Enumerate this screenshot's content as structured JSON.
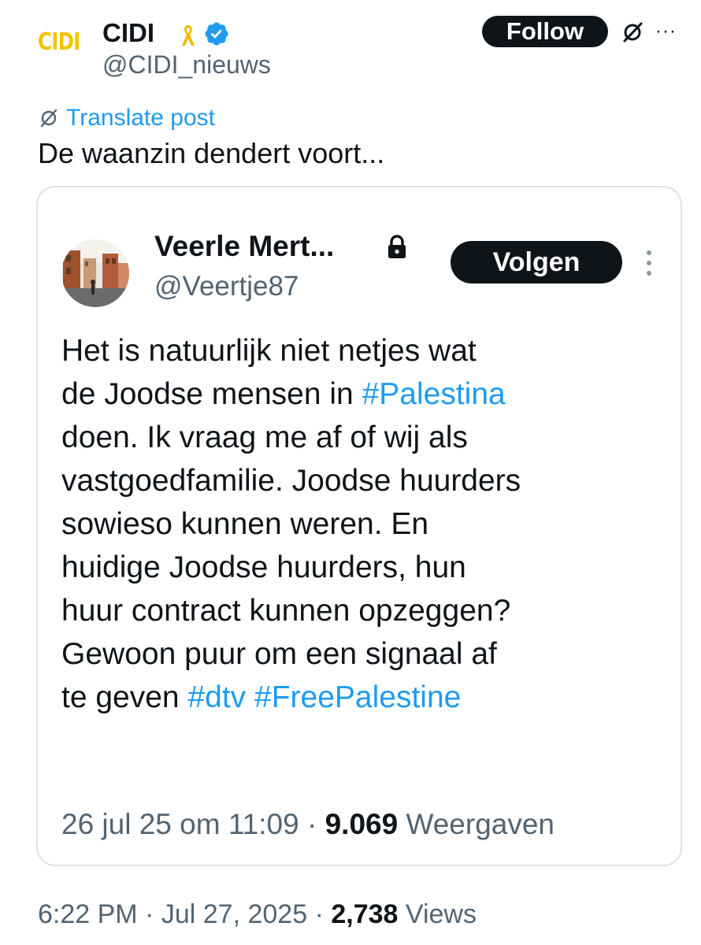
{
  "post": {
    "logo_text": "CIDI",
    "author_name": "CIDI",
    "author_handle": "@CIDI_nieuws",
    "follow_label": "Follow",
    "more_label": "···",
    "translate_label": "Translate post",
    "text": "De waanzin dendert voort...",
    "time": "6:22 PM",
    "date": "Jul 27, 2025",
    "views_count": "2,738",
    "views_label": "Views"
  },
  "quote": {
    "author_name": "Veerle Mert...",
    "author_handle": "@Veertje87",
    "follow_label": "Volgen",
    "lines": [
      [
        {
          "t": "Het is natuurlijk niet netjes wat"
        }
      ],
      [
        {
          "t": "de Joodse mensen in "
        },
        {
          "t": "#Palestina",
          "tag": true
        }
      ],
      [
        {
          "t": "doen. Ik vraag me af of wij als"
        }
      ],
      [
        {
          "t": "vastgoedfamilie. Joodse huurders"
        }
      ],
      [
        {
          "t": "sowieso kunnen weren. En"
        }
      ],
      [
        {
          "t": "huidige Joodse huurders, hun"
        }
      ],
      [
        {
          "t": "huur contract kunnen opzeggen?"
        }
      ],
      [
        {
          "t": "Gewoon puur om een signaal af"
        }
      ],
      [
        {
          "t": "te geven "
        },
        {
          "t": "#dtv",
          "tag": true
        },
        {
          "t": " "
        },
        {
          "t": "#FreePalestine",
          "tag": true
        }
      ]
    ],
    "date": "26 jul 25 om 11:09",
    "views_count": "9.069",
    "views_label": "Weergaven"
  },
  "colors": {
    "accent": "#1d9bf0",
    "text": "#0f1419",
    "muted": "#536471",
    "logo": "#f5c400",
    "ribbon": "#f5b800"
  },
  "icons": [
    "verified-badge-icon",
    "yellow-ribbon-icon",
    "grok-icon",
    "more-icon",
    "translate-icon",
    "lock-icon",
    "vertical-more-icon"
  ]
}
